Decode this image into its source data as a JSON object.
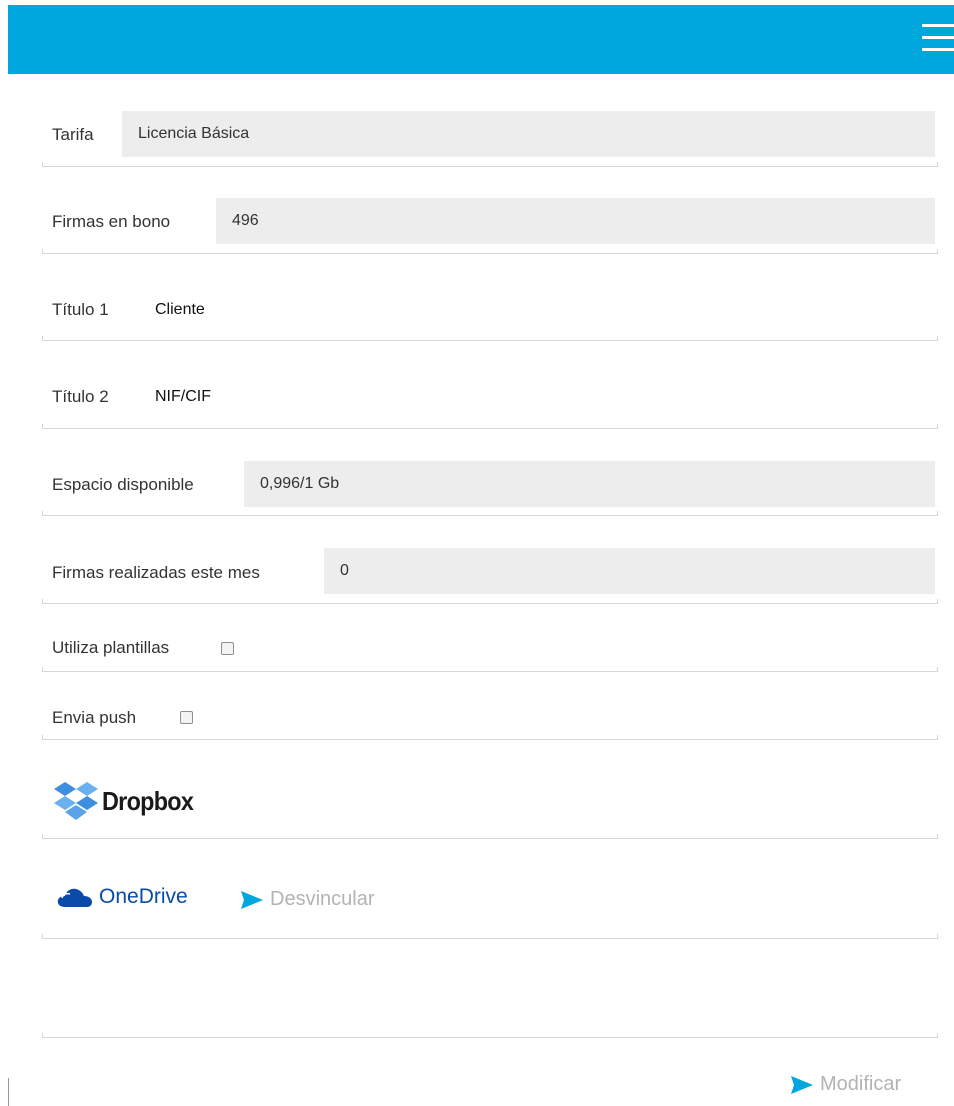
{
  "header": {
    "menu_icon": "hamburger-menu-icon",
    "bg_color": "#00a6de"
  },
  "fields": {
    "tarifa": {
      "label": "Tarifa",
      "value": "Licencia Básica"
    },
    "firmas_bono": {
      "label": "Firmas en bono",
      "value": "496"
    },
    "titulo1": {
      "label": "Título 1",
      "value": "Cliente"
    },
    "titulo2": {
      "label": "Título 2",
      "value": "NIF/CIF"
    },
    "espacio": {
      "label": "Espacio disponible",
      "value": "0,996/1 Gb"
    },
    "firmas_mes": {
      "label": "Firmas realizadas este mes",
      "value": "0"
    },
    "plantillas": {
      "label": "Utiliza plantillas",
      "checked": false
    },
    "push": {
      "label": "Envia push",
      "checked": false
    }
  },
  "integrations": {
    "dropbox": {
      "label": "Dropbox",
      "icon": "dropbox-logo-icon"
    },
    "onedrive": {
      "label": "OneDrive",
      "icon": "onedrive-cloud-icon",
      "unlink_label": "Desvincular"
    }
  },
  "actions": {
    "modify_label": "Modificar",
    "accent_color": "#00a6de"
  }
}
